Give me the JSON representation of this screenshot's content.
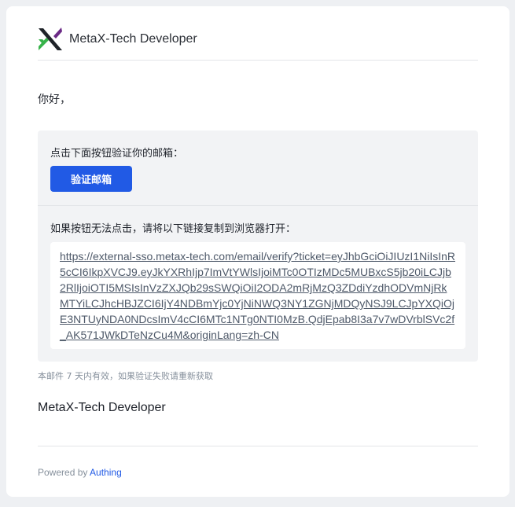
{
  "header": {
    "brand_name": "MetaX-Tech Developer",
    "logo_icon": "metax-logo-icon"
  },
  "greeting": "你好，",
  "verify": {
    "instruction": "点击下面按钮验证你的邮箱：",
    "button_label": "验证邮箱",
    "fallback_text": "如果按钮无法点击，请将以下链接复制到浏览器打开：",
    "link": "https://external-sso.metax-tech.com/email/verify?ticket=eyJhbGciOiJIUzI1NiIsInR5cCI6IkpXVCJ9.eyJkYXRhIjp7ImVtYWlsIjoiMTc0OTIzMDc5MUBxcS5jb20iLCJjb2RlIjoiOTI5MSIsInVzZXJQb29sSWQiOiI2ODA2mRjMzQ3ZDdiYzdhODVmNjRkMTYiLCJhcHBJZCI6IjY4NDBmYjc0YjNiNWQ3NY1ZGNjMDQyNSJ9LCJpYXQiOjE3NTUyNDA0NDcsImV4cCI6MTc1NTg0NTI0MzB.QdjEpab8I3a7v7wDVrblSVc2f_AK571JWkDTeNzCu4M&originLang=zh-CN"
  },
  "validity_note": "本邮件 7 天内有效，如果验证失败请重新获取",
  "signature": "MetaX-Tech Developer",
  "footer": {
    "powered_by": "Powered by ",
    "provider": "Authing"
  },
  "colors": {
    "accent": "#215ae5",
    "logo_green": "#37b34a",
    "logo_purple": "#6b2a86",
    "logo_dark": "#1f2329"
  }
}
